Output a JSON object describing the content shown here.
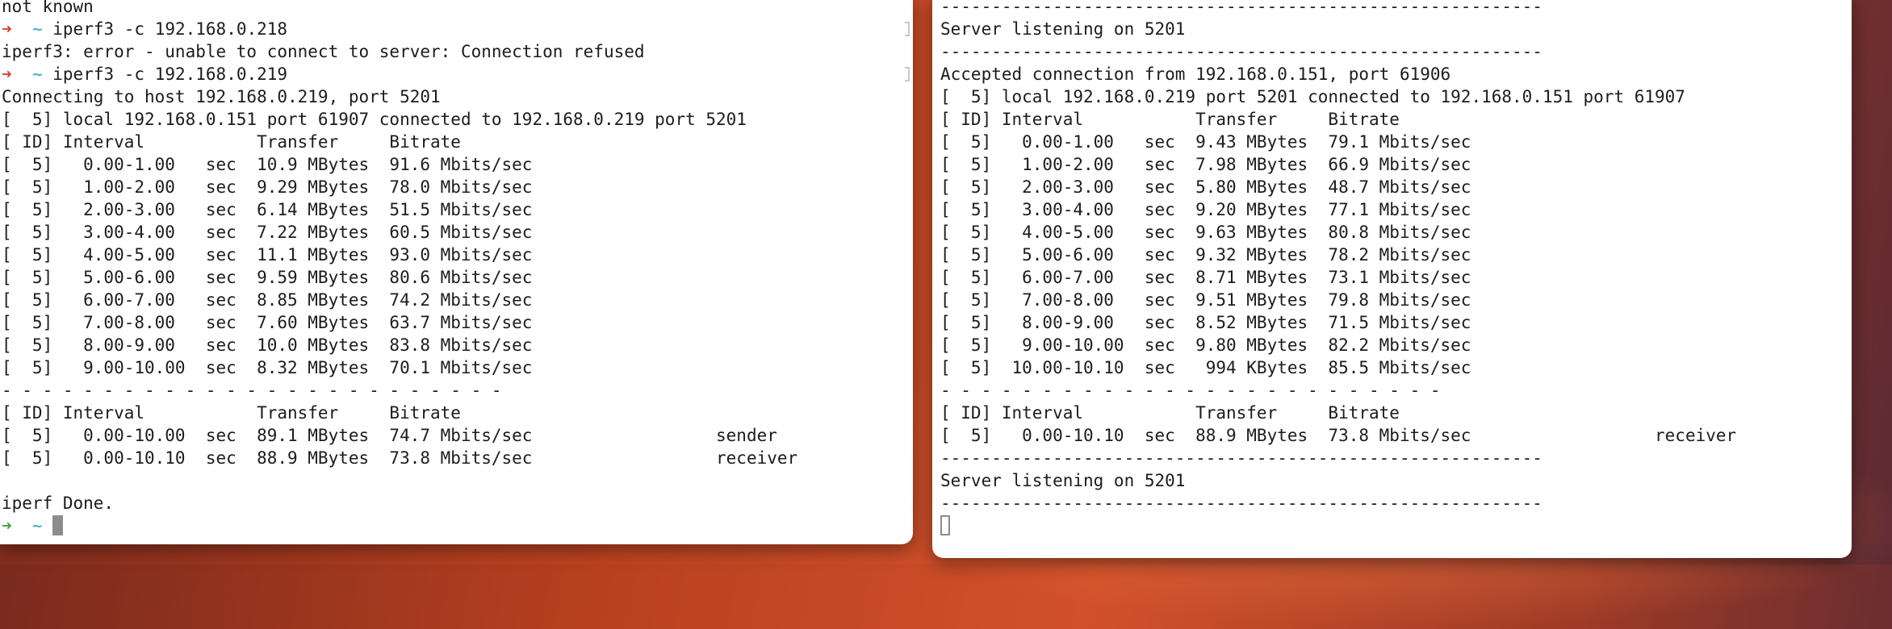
{
  "left_terminal": {
    "prompt_arrow": "➜",
    "prompt_dir": "~",
    "lines": [
      {
        "kind": "text",
        "text": "not known"
      },
      {
        "kind": "cmd",
        "arrow": "red",
        "text": "iperf3 -c 192.168.0.218"
      },
      {
        "kind": "text",
        "text": "iperf3: error - unable to connect to server: Connection refused"
      },
      {
        "kind": "cmd",
        "arrow": "red",
        "text": "iperf3 -c 192.168.0.219"
      },
      {
        "kind": "text",
        "text": "Connecting to host 192.168.0.219, port 5201"
      },
      {
        "kind": "text",
        "text": "[  5] local 192.168.0.151 port 61907 connected to 192.168.0.219 port 5201"
      },
      {
        "kind": "text",
        "text": "[ ID] Interval           Transfer     Bitrate"
      },
      {
        "kind": "text",
        "text": "[  5]   0.00-1.00   sec  10.9 MBytes  91.6 Mbits/sec"
      },
      {
        "kind": "text",
        "text": "[  5]   1.00-2.00   sec  9.29 MBytes  78.0 Mbits/sec"
      },
      {
        "kind": "text",
        "text": "[  5]   2.00-3.00   sec  6.14 MBytes  51.5 Mbits/sec"
      },
      {
        "kind": "text",
        "text": "[  5]   3.00-4.00   sec  7.22 MBytes  60.5 Mbits/sec"
      },
      {
        "kind": "text",
        "text": "[  5]   4.00-5.00   sec  11.1 MBytes  93.0 Mbits/sec"
      },
      {
        "kind": "text",
        "text": "[  5]   5.00-6.00   sec  9.59 MBytes  80.6 Mbits/sec"
      },
      {
        "kind": "text",
        "text": "[  5]   6.00-7.00   sec  8.85 MBytes  74.2 Mbits/sec"
      },
      {
        "kind": "text",
        "text": "[  5]   7.00-8.00   sec  7.60 MBytes  63.7 Mbits/sec"
      },
      {
        "kind": "text",
        "text": "[  5]   8.00-9.00   sec  10.0 MBytes  83.8 Mbits/sec"
      },
      {
        "kind": "text",
        "text": "[  5]   9.00-10.00  sec  8.32 MBytes  70.1 Mbits/sec"
      },
      {
        "kind": "text",
        "text": "- - - - - - - - - - - - - - - - - - - - - - - - -"
      },
      {
        "kind": "text",
        "text": "[ ID] Interval           Transfer     Bitrate"
      },
      {
        "kind": "text",
        "text": "[  5]   0.00-10.00  sec  89.1 MBytes  74.7 Mbits/sec                  sender"
      },
      {
        "kind": "text",
        "text": "[  5]   0.00-10.10  sec  88.9 MBytes  73.8 Mbits/sec                  receiver"
      },
      {
        "kind": "text",
        "text": ""
      },
      {
        "kind": "text",
        "text": "iperf Done."
      },
      {
        "kind": "prompt",
        "arrow": "green",
        "text": ""
      }
    ]
  },
  "right_terminal": {
    "lines": [
      {
        "kind": "text",
        "text": "-----------------------------------------------------------"
      },
      {
        "kind": "text",
        "text": "Server listening on 5201"
      },
      {
        "kind": "text",
        "text": "-----------------------------------------------------------"
      },
      {
        "kind": "text",
        "text": "Accepted connection from 192.168.0.151, port 61906"
      },
      {
        "kind": "text",
        "text": "[  5] local 192.168.0.219 port 5201 connected to 192.168.0.151 port 61907"
      },
      {
        "kind": "text",
        "text": "[ ID] Interval           Transfer     Bitrate"
      },
      {
        "kind": "text",
        "text": "[  5]   0.00-1.00   sec  9.43 MBytes  79.1 Mbits/sec"
      },
      {
        "kind": "text",
        "text": "[  5]   1.00-2.00   sec  7.98 MBytes  66.9 Mbits/sec"
      },
      {
        "kind": "text",
        "text": "[  5]   2.00-3.00   sec  5.80 MBytes  48.7 Mbits/sec"
      },
      {
        "kind": "text",
        "text": "[  5]   3.00-4.00   sec  9.20 MBytes  77.1 Mbits/sec"
      },
      {
        "kind": "text",
        "text": "[  5]   4.00-5.00   sec  9.63 MBytes  80.8 Mbits/sec"
      },
      {
        "kind": "text",
        "text": "[  5]   5.00-6.00   sec  9.32 MBytes  78.2 Mbits/sec"
      },
      {
        "kind": "text",
        "text": "[  5]   6.00-7.00   sec  8.71 MBytes  73.1 Mbits/sec"
      },
      {
        "kind": "text",
        "text": "[  5]   7.00-8.00   sec  9.51 MBytes  79.8 Mbits/sec"
      },
      {
        "kind": "text",
        "text": "[  5]   8.00-9.00   sec  8.52 MBytes  71.5 Mbits/sec"
      },
      {
        "kind": "text",
        "text": "[  5]   9.00-10.00  sec  9.80 MBytes  82.2 Mbits/sec"
      },
      {
        "kind": "text",
        "text": "[  5]  10.00-10.10  sec   994 KBytes  85.5 Mbits/sec"
      },
      {
        "kind": "text",
        "text": "- - - - - - - - - - - - - - - - - - - - - - - - -"
      },
      {
        "kind": "text",
        "text": "[ ID] Interval           Transfer     Bitrate"
      },
      {
        "kind": "text",
        "text": "[  5]   0.00-10.10  sec  88.9 MBytes  73.8 Mbits/sec                  receiver"
      },
      {
        "kind": "text",
        "text": "-----------------------------------------------------------"
      },
      {
        "kind": "text",
        "text": "Server listening on 5201"
      },
      {
        "kind": "text",
        "text": "-----------------------------------------------------------"
      },
      {
        "kind": "cursor",
        "text": ""
      }
    ]
  },
  "colors": {
    "prompt_arrow_error": "#d9412f",
    "prompt_arrow_ok": "#3aa642",
    "prompt_dir": "#3aa3b8",
    "terminal_bg": "#ffffff",
    "terminal_text": "#1c1c1c"
  }
}
